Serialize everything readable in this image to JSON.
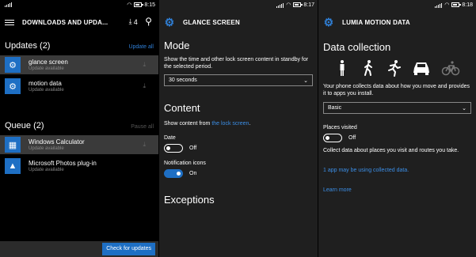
{
  "panel1": {
    "status": {
      "time": "8:15"
    },
    "title": "DOWNLOADS AND UPDA...",
    "download_count": "4",
    "updates_header": "Updates (2)",
    "update_all": "Update all",
    "updates": [
      {
        "name": "glance screen",
        "status": "Update available",
        "icon": "gear-icon"
      },
      {
        "name": "motion data",
        "status": "Update available",
        "icon": "gear-icon"
      }
    ],
    "queue_header": "Queue (2)",
    "pause_all": "Pause all",
    "queue": [
      {
        "name": "Windows Calculator",
        "status": "Update available",
        "icon": "calculator-icon"
      },
      {
        "name": "Microsoft Photos plug-in",
        "status": "Update available",
        "icon": "photos-icon"
      }
    ],
    "check_button": "Check for updates"
  },
  "panel2": {
    "status": {
      "time": "8:17"
    },
    "title": "GLANCE SCREEN",
    "mode_heading": "Mode",
    "mode_desc": "Show the time and other lock screen content in standby for the selected period.",
    "mode_value": "30 seconds",
    "content_heading": "Content",
    "content_text_prefix": "Show content from",
    "content_link": "the lock screen",
    "content_text_suffix": ".",
    "date_label": "Date",
    "date_state": "Off",
    "notif_label": "Notification icons",
    "notif_state": "On",
    "exceptions_heading": "Exceptions"
  },
  "panel3": {
    "status": {
      "time": "8:18"
    },
    "title": "LUMIA MOTION DATA",
    "heading": "Data collection",
    "activity_icons": [
      "standing-icon",
      "walking-icon",
      "running-icon",
      "car-icon",
      "bicycle-icon"
    ],
    "desc": "Your phone collects data about how you move and provides it to apps you install.",
    "level_value": "Basic",
    "places_label": "Places visited",
    "places_state": "Off",
    "places_desc": "Collect data about places you visit and routes you take.",
    "apps_link": "1 app may be using collected data.",
    "learn_more": "Learn more"
  },
  "colors": {
    "accent": "#1e6fc4",
    "link": "#3b8ee6",
    "panel_bg": "#1f1f1f"
  }
}
